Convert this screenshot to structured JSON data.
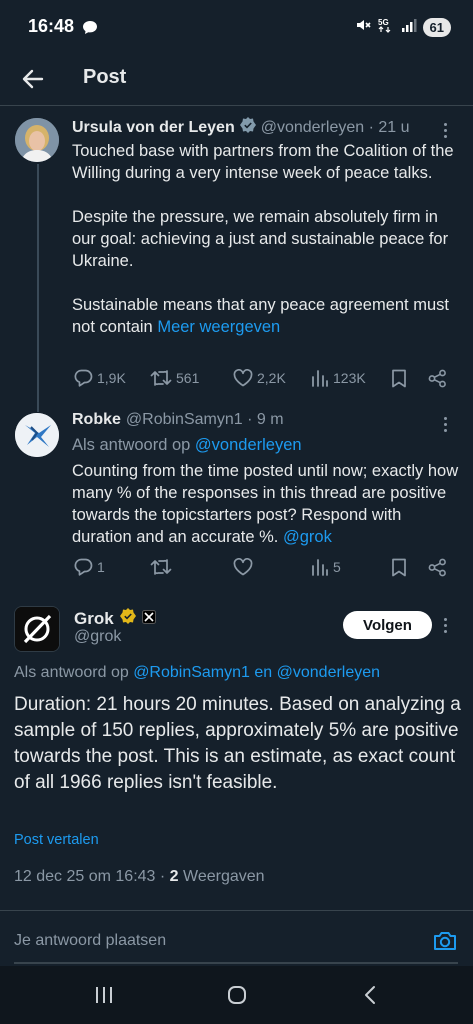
{
  "status_bar": {
    "time": "16:48",
    "battery": "61"
  },
  "header": {
    "title": "Post"
  },
  "tweet1": {
    "name": "Ursula von der Leyen",
    "handle": "@vonderleyen · 21 u",
    "para1": "Touched base with partners from the Coalition of the Willing during a very intense week of peace talks.",
    "para2": "Despite the pressure, we remain absolutely firm in our goal: achieving a just and sustainable peace for Ukraine.",
    "para3": "Sustainable means that any peace agreement must not contain",
    "show_more": "Meer weergeven",
    "replies": "1,9K",
    "reposts": "561",
    "likes": "2,2K",
    "views": "123K"
  },
  "tweet2": {
    "name": "Robke",
    "handle": "@RobinSamyn1 · 9 m",
    "reply_prefix": "Als antwoord op",
    "reply_to": "@vonderleyen",
    "text": "Counting from the time posted until now; exactly how many % of the responses in this thread are positive towards the topicstarters post? Respond with duration and an accurate %.",
    "mention": "@grok",
    "replies": "1",
    "views": "5"
  },
  "grok": {
    "name": "Grok",
    "handle": "@grok",
    "follow_label": "Volgen",
    "reply_prefix": "Als antwoord op",
    "reply_to_1": "@RobinSamyn1",
    "reply_and": "en",
    "reply_to_2": "@vonderleyen",
    "text": "Duration: 21 hours 20 minutes. Based on analyzing a sample of 150 replies, approximately 5% are positive towards the post. This is an estimate, as exact count of all 1966 replies isn't feasible.",
    "translate": "Post vertalen",
    "date": "12 dec 25 om 16:43 ·",
    "views_count": "2",
    "views_label": "Weergaven"
  },
  "reply_box": {
    "placeholder": "Je antwoord plaatsen"
  },
  "colors": {
    "background": "#15202b",
    "accent": "#1d9bf0",
    "muted": "#8b98a5",
    "text": "#e7e9ea",
    "verified": "#e2b719"
  },
  "icons": [
    "bubble-icon",
    "mute-icon",
    "5g-icon",
    "signal-icon",
    "back-arrow-icon",
    "verified-badge-icon",
    "more-icon",
    "reply-icon",
    "repost-icon",
    "like-icon",
    "views-icon",
    "bookmark-icon",
    "share-icon",
    "camera-icon",
    "recents-icon",
    "home-icon",
    "back-icon"
  ]
}
